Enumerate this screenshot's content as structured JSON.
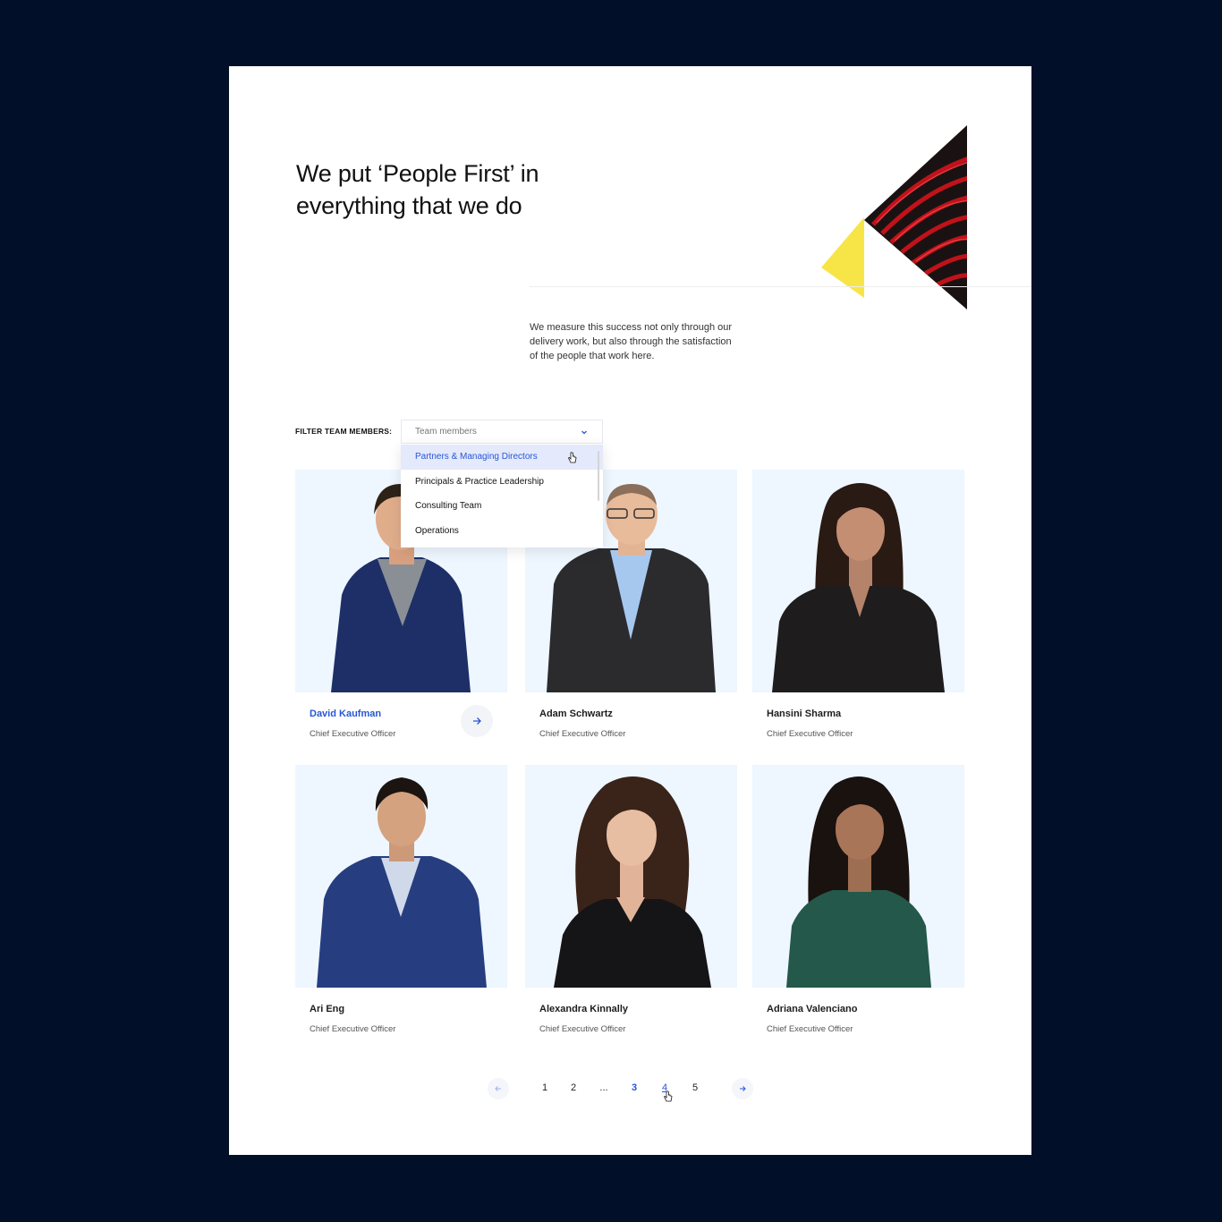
{
  "hero": {
    "title": "We put ‘People First’ in everything that we do",
    "body": "We measure this success not only through our delivery work, but also through the satisfaction of the people that work here."
  },
  "filter": {
    "label": "FILTER TEAM MEMBERS:",
    "placeholder": "Team members",
    "options": [
      {
        "label": "Partners & Managing Directors",
        "highlighted": true
      },
      {
        "label": "Principals & Practice Leadership",
        "highlighted": false
      },
      {
        "label": "Consulting Team",
        "highlighted": false
      },
      {
        "label": "Operations",
        "highlighted": false
      }
    ]
  },
  "team": [
    {
      "name": "David Kaufman",
      "role": "Chief Executive Officer",
      "hovered": true,
      "icon": "arrow-right-icon"
    },
    {
      "name": "Adam Schwartz",
      "role": "Chief Executive Officer"
    },
    {
      "name": "Hansini Sharma",
      "role": "Chief Executive Officer"
    },
    {
      "name": "Ari Eng",
      "role": "Chief Executive Officer"
    },
    {
      "name": "Alexandra Kinnally",
      "role": "Chief Executive Officer"
    },
    {
      "name": "Adriana Valenciano",
      "role": "Chief Executive Officer"
    }
  ],
  "pagination": {
    "prev_icon": "arrow-left-icon",
    "next_icon": "arrow-right-icon",
    "pages": [
      "1",
      "2",
      "...",
      "3",
      "4",
      "5"
    ],
    "current": "3",
    "hovered": "4"
  },
  "colors": {
    "background": "#020f29",
    "accent": "#2756d6",
    "photo_bg": "#eef6ff",
    "yellow": "#f7e548",
    "red": "#c0121a"
  }
}
